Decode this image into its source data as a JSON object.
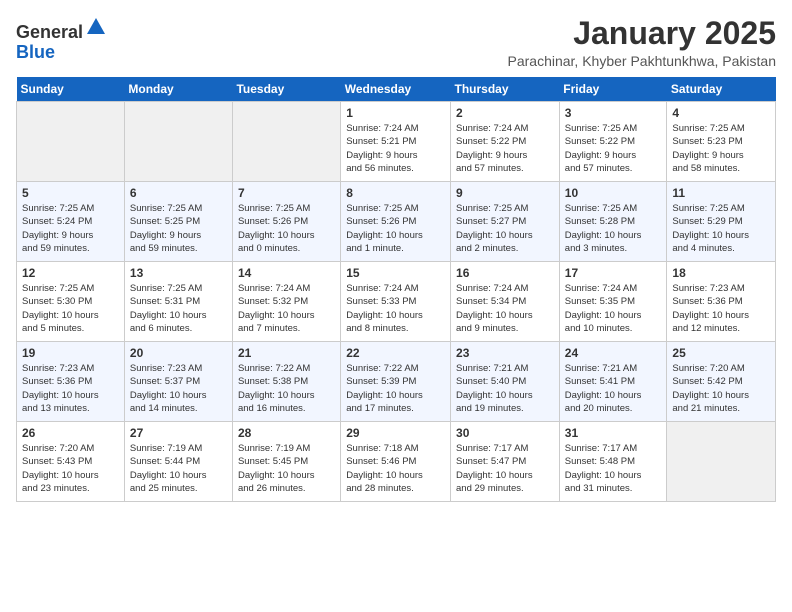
{
  "header": {
    "logo_line1": "General",
    "logo_line2": "Blue",
    "month_title": "January 2025",
    "subtitle": "Parachinar, Khyber Pakhtunkhwa, Pakistan"
  },
  "weekdays": [
    "Sunday",
    "Monday",
    "Tuesday",
    "Wednesday",
    "Thursday",
    "Friday",
    "Saturday"
  ],
  "weeks": [
    [
      {
        "day": "",
        "info": ""
      },
      {
        "day": "",
        "info": ""
      },
      {
        "day": "",
        "info": ""
      },
      {
        "day": "1",
        "info": "Sunrise: 7:24 AM\nSunset: 5:21 PM\nDaylight: 9 hours\nand 56 minutes."
      },
      {
        "day": "2",
        "info": "Sunrise: 7:24 AM\nSunset: 5:22 PM\nDaylight: 9 hours\nand 57 minutes."
      },
      {
        "day": "3",
        "info": "Sunrise: 7:25 AM\nSunset: 5:22 PM\nDaylight: 9 hours\nand 57 minutes."
      },
      {
        "day": "4",
        "info": "Sunrise: 7:25 AM\nSunset: 5:23 PM\nDaylight: 9 hours\nand 58 minutes."
      }
    ],
    [
      {
        "day": "5",
        "info": "Sunrise: 7:25 AM\nSunset: 5:24 PM\nDaylight: 9 hours\nand 59 minutes."
      },
      {
        "day": "6",
        "info": "Sunrise: 7:25 AM\nSunset: 5:25 PM\nDaylight: 9 hours\nand 59 minutes."
      },
      {
        "day": "7",
        "info": "Sunrise: 7:25 AM\nSunset: 5:26 PM\nDaylight: 10 hours\nand 0 minutes."
      },
      {
        "day": "8",
        "info": "Sunrise: 7:25 AM\nSunset: 5:26 PM\nDaylight: 10 hours\nand 1 minute."
      },
      {
        "day": "9",
        "info": "Sunrise: 7:25 AM\nSunset: 5:27 PM\nDaylight: 10 hours\nand 2 minutes."
      },
      {
        "day": "10",
        "info": "Sunrise: 7:25 AM\nSunset: 5:28 PM\nDaylight: 10 hours\nand 3 minutes."
      },
      {
        "day": "11",
        "info": "Sunrise: 7:25 AM\nSunset: 5:29 PM\nDaylight: 10 hours\nand 4 minutes."
      }
    ],
    [
      {
        "day": "12",
        "info": "Sunrise: 7:25 AM\nSunset: 5:30 PM\nDaylight: 10 hours\nand 5 minutes."
      },
      {
        "day": "13",
        "info": "Sunrise: 7:25 AM\nSunset: 5:31 PM\nDaylight: 10 hours\nand 6 minutes."
      },
      {
        "day": "14",
        "info": "Sunrise: 7:24 AM\nSunset: 5:32 PM\nDaylight: 10 hours\nand 7 minutes."
      },
      {
        "day": "15",
        "info": "Sunrise: 7:24 AM\nSunset: 5:33 PM\nDaylight: 10 hours\nand 8 minutes."
      },
      {
        "day": "16",
        "info": "Sunrise: 7:24 AM\nSunset: 5:34 PM\nDaylight: 10 hours\nand 9 minutes."
      },
      {
        "day": "17",
        "info": "Sunrise: 7:24 AM\nSunset: 5:35 PM\nDaylight: 10 hours\nand 10 minutes."
      },
      {
        "day": "18",
        "info": "Sunrise: 7:23 AM\nSunset: 5:36 PM\nDaylight: 10 hours\nand 12 minutes."
      }
    ],
    [
      {
        "day": "19",
        "info": "Sunrise: 7:23 AM\nSunset: 5:36 PM\nDaylight: 10 hours\nand 13 minutes."
      },
      {
        "day": "20",
        "info": "Sunrise: 7:23 AM\nSunset: 5:37 PM\nDaylight: 10 hours\nand 14 minutes."
      },
      {
        "day": "21",
        "info": "Sunrise: 7:22 AM\nSunset: 5:38 PM\nDaylight: 10 hours\nand 16 minutes."
      },
      {
        "day": "22",
        "info": "Sunrise: 7:22 AM\nSunset: 5:39 PM\nDaylight: 10 hours\nand 17 minutes."
      },
      {
        "day": "23",
        "info": "Sunrise: 7:21 AM\nSunset: 5:40 PM\nDaylight: 10 hours\nand 19 minutes."
      },
      {
        "day": "24",
        "info": "Sunrise: 7:21 AM\nSunset: 5:41 PM\nDaylight: 10 hours\nand 20 minutes."
      },
      {
        "day": "25",
        "info": "Sunrise: 7:20 AM\nSunset: 5:42 PM\nDaylight: 10 hours\nand 21 minutes."
      }
    ],
    [
      {
        "day": "26",
        "info": "Sunrise: 7:20 AM\nSunset: 5:43 PM\nDaylight: 10 hours\nand 23 minutes."
      },
      {
        "day": "27",
        "info": "Sunrise: 7:19 AM\nSunset: 5:44 PM\nDaylight: 10 hours\nand 25 minutes."
      },
      {
        "day": "28",
        "info": "Sunrise: 7:19 AM\nSunset: 5:45 PM\nDaylight: 10 hours\nand 26 minutes."
      },
      {
        "day": "29",
        "info": "Sunrise: 7:18 AM\nSunset: 5:46 PM\nDaylight: 10 hours\nand 28 minutes."
      },
      {
        "day": "30",
        "info": "Sunrise: 7:17 AM\nSunset: 5:47 PM\nDaylight: 10 hours\nand 29 minutes."
      },
      {
        "day": "31",
        "info": "Sunrise: 7:17 AM\nSunset: 5:48 PM\nDaylight: 10 hours\nand 31 minutes."
      },
      {
        "day": "",
        "info": ""
      }
    ]
  ]
}
